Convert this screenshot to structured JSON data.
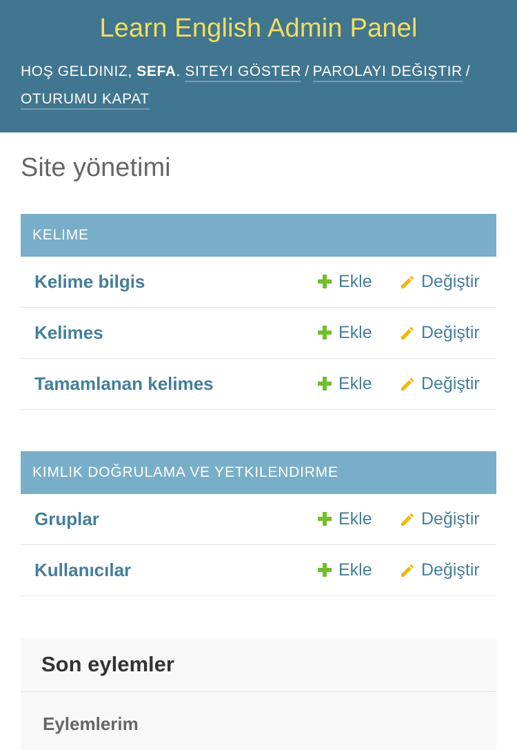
{
  "header": {
    "site_name": "Learn English Admin Panel",
    "welcome": "Hoş geldiniz,",
    "username": "Sefa",
    "username_suffix": ".",
    "view_site": "Siteyi göster",
    "change_password": "Parolayı değiştir",
    "logout": "Oturumu kapat",
    "separator": "/"
  },
  "page": {
    "title": "Site yönetimi"
  },
  "apps": [
    {
      "caption": "Kelime",
      "models": [
        {
          "name": "Kelime bilgis",
          "add": "Ekle",
          "change": "Değiştir"
        },
        {
          "name": "Kelimes",
          "add": "Ekle",
          "change": "Değiştir"
        },
        {
          "name": "Tamamlanan kelimes",
          "add": "Ekle",
          "change": "Değiştir"
        }
      ]
    },
    {
      "caption": "Kimlik doğrulama ve yetkilendirme",
      "models": [
        {
          "name": "Gruplar",
          "add": "Ekle",
          "change": "Değiştir"
        },
        {
          "name": "Kullanıcılar",
          "add": "Ekle",
          "change": "Değiştir"
        }
      ]
    }
  ],
  "recent_actions": {
    "title": "Son eylemler",
    "subtitle": "Eylemlerim"
  },
  "icons": {
    "add": "plus-icon",
    "change": "pencil-icon"
  },
  "colors": {
    "header_bg": "#417690",
    "site_name": "#f5dd5d",
    "module_caption_bg": "#79aec8",
    "link": "#447e9b",
    "add_icon": "#70bf2b",
    "change_icon": "#efb80b"
  }
}
